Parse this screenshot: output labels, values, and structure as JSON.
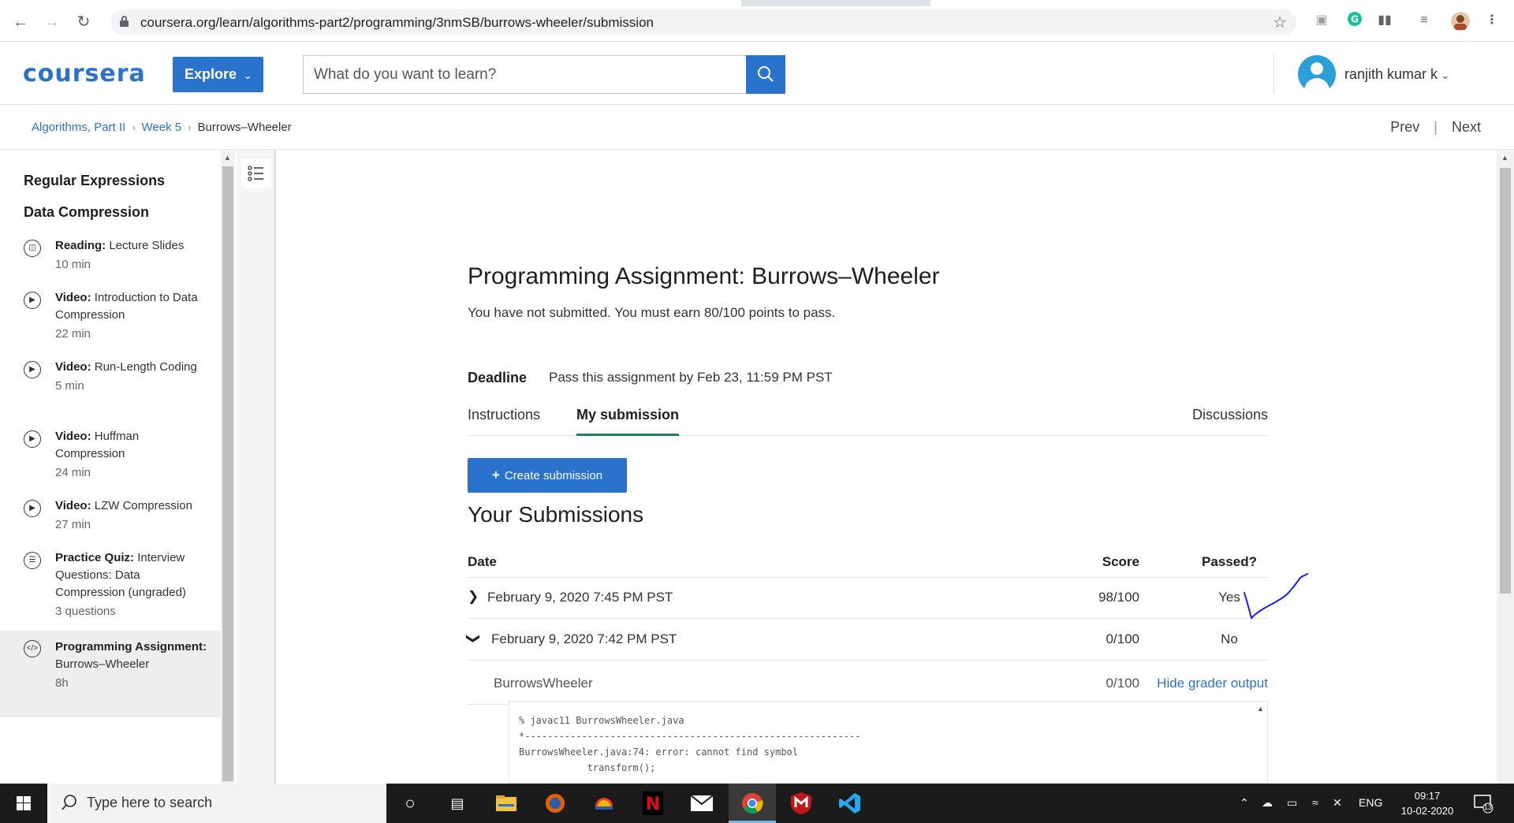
{
  "browser": {
    "url": "coursera.org/learn/algorithms-part2/programming/3nmSB/burrows-wheeler/submission"
  },
  "header": {
    "logo": "coursera",
    "explore_label": "Explore",
    "search_placeholder": "What do you want to learn?",
    "user_name": "ranjith kumar k"
  },
  "breadcrumb": {
    "items": [
      "Algorithms, Part II",
      "Week 5",
      "Burrows–Wheeler"
    ],
    "prev": "Prev",
    "next": "Next"
  },
  "sidebar": {
    "headings": [
      "Regular Expressions",
      "Data Compression"
    ],
    "items": [
      {
        "type": "Reading:",
        "title": "Lecture Slides",
        "duration": "10 min",
        "icon": "book-icon"
      },
      {
        "type": "Video:",
        "title": "Introduction to Data Compression",
        "duration": "22 min",
        "icon": "play-icon"
      },
      {
        "type": "Video:",
        "title": "Run-Length Coding",
        "duration": "5 min",
        "icon": "play-icon"
      },
      {
        "type": "Video:",
        "title": "Huffman Compression",
        "duration": "24 min",
        "icon": "play-icon"
      },
      {
        "type": "Video:",
        "title": "LZW Compression",
        "duration": "27 min",
        "icon": "play-icon"
      },
      {
        "type": "Practice Quiz:",
        "title": "Interview Questions: Data Compression (ungraded)",
        "duration": "3 questions",
        "icon": "quiz-icon"
      },
      {
        "type": "Programming Assignment:",
        "title": "Burrows–Wheeler",
        "duration": "8h",
        "icon": "code-icon"
      }
    ]
  },
  "main": {
    "title": "Programming Assignment: Burrows–Wheeler",
    "subtitle": "You have not submitted. You must earn 80/100 points to pass.",
    "deadline_label": "Deadline",
    "deadline_value": "Pass this assignment by Feb 23, 11:59 PM PST",
    "tabs": [
      "Instructions",
      "My submission",
      "Discussions"
    ],
    "create_button": "Create submission",
    "submissions_title": "Your Submissions",
    "columns": [
      "Date",
      "Score",
      "Passed?"
    ],
    "rows": [
      {
        "date": "February 9, 2020 7:45 PM PST",
        "score": "98/100",
        "passed": "Yes"
      },
      {
        "date": "February 9, 2020 7:42 PM PST",
        "score": "0/100",
        "passed": "No"
      }
    ],
    "detail": {
      "name": "BurrowsWheeler",
      "score": "0/100",
      "toggle": "Hide grader output",
      "output": "% javac11 BurrowsWheeler.java\n*-----------------------------------------------------------\nBurrowsWheeler.java:74: error: cannot find symbol\n            transform();"
    }
  },
  "taskbar": {
    "search_placeholder": "Type here to search",
    "language": "ENG",
    "time": "09:17",
    "date": "10-02-2020",
    "notification_count": "13"
  },
  "colors": {
    "accent": "#2a73cc",
    "tab_underline": "#1f8354",
    "annotation": "#1a1aff"
  }
}
